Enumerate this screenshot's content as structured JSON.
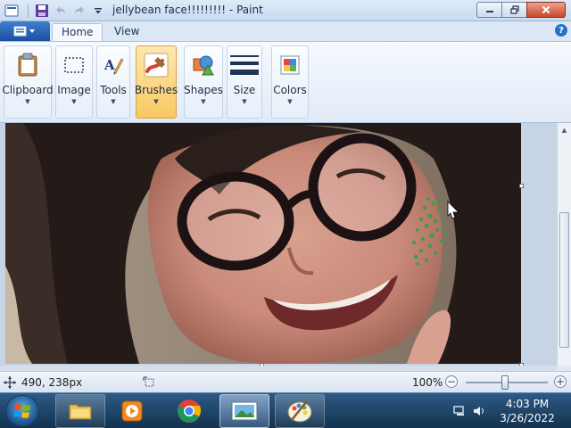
{
  "window": {
    "title": "jellybean face!!!!!!!!! - Paint"
  },
  "ribbon": {
    "tabs": [
      {
        "label": "Home",
        "active": true
      },
      {
        "label": "View",
        "active": false
      }
    ],
    "groups": [
      {
        "label": "Clipboard",
        "icon": "clipboard-icon"
      },
      {
        "label": "Image",
        "icon": "select-rectangle-icon"
      },
      {
        "label": "Tools",
        "icon": "tools-icon"
      },
      {
        "label": "Brushes",
        "icon": "brush-icon",
        "active": true
      },
      {
        "label": "Shapes",
        "icon": "shapes-icon"
      },
      {
        "label": "Size",
        "icon": "line-size-icon"
      },
      {
        "label": "Colors",
        "icon": "color-palette-icon"
      }
    ]
  },
  "status": {
    "cursor_position": "490, 238px",
    "zoom": "100%",
    "zoom_level": 1.0
  },
  "taskbar": {
    "apps": [
      {
        "icon": "windows-explorer-icon"
      },
      {
        "icon": "media-player-icon"
      },
      {
        "icon": "chrome-icon"
      },
      {
        "icon": "photo-viewer-icon",
        "active": true
      },
      {
        "icon": "paint-icon"
      }
    ],
    "time": "4:03 PM",
    "date": "3/26/2022"
  },
  "colors": {
    "ribbon_active": "#f8c862",
    "brush_stroke": "#2fa53c",
    "title_bar": "#c9dbef",
    "taskbar": "#1d4266"
  }
}
